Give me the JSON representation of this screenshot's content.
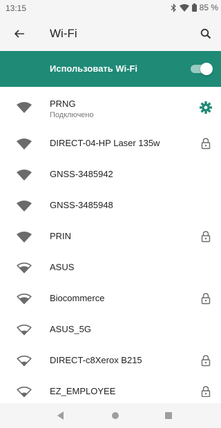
{
  "status_bar": {
    "time": "13:15",
    "battery": "85 %",
    "icons": [
      "bluetooth-icon",
      "wifi-signal-icon",
      "battery-icon"
    ]
  },
  "app_bar": {
    "title": "Wi-Fi",
    "back_icon": "arrow-left-icon",
    "search_icon": "search-icon"
  },
  "master_switch": {
    "label": "Использовать Wi-Fi",
    "on": true
  },
  "colors": {
    "accent": "#1f8a76",
    "bar_background": "#f5f5f5",
    "text": "#222222",
    "secondary_text": "#777777",
    "icon_gray": "#6b6b6b"
  },
  "networks": [
    {
      "name": "PRNG",
      "status": "Подключено",
      "connected": true,
      "secured": false,
      "signal": "full"
    },
    {
      "name": "DIRECT-04-HP Laser 135w",
      "secured": true,
      "signal": "full"
    },
    {
      "name": "GNSS-3485942",
      "secured": false,
      "signal": "full"
    },
    {
      "name": "GNSS-3485948",
      "secured": false,
      "signal": "full"
    },
    {
      "name": "PRIN",
      "secured": true,
      "signal": "full"
    },
    {
      "name": "ASUS",
      "secured": false,
      "signal": "medium"
    },
    {
      "name": "Biocommerce",
      "secured": true,
      "signal": "medium"
    },
    {
      "name": "ASUS_5G",
      "secured": false,
      "signal": "low"
    },
    {
      "name": "DIRECT-c8Xerox B215",
      "secured": true,
      "signal": "low"
    },
    {
      "name": "EZ_EMPLOYEE",
      "secured": true,
      "signal": "low"
    }
  ]
}
